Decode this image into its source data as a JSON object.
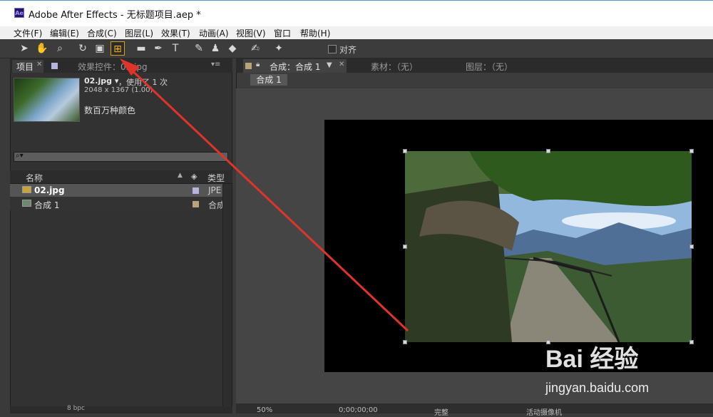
{
  "window": {
    "title": "Adobe After Effects - 无标题项目.aep *",
    "logo_text": "Ae"
  },
  "menu": [
    "文件(F)",
    "编辑(E)",
    "合成(C)",
    "图层(L)",
    "效果(T)",
    "动画(A)",
    "视图(V)",
    "窗口",
    "帮助(H)"
  ],
  "toolbar": {
    "tools": [
      "selection-tool",
      "hand-tool",
      "zoom-tool",
      "rotation-tool",
      "camera-tool",
      "pan-behind-tool",
      "rectangle-tool",
      "pen-tool",
      "text-tool",
      "brush-tool",
      "clone-stamp-tool",
      "eraser-tool",
      "roto-brush-tool",
      "puppet-pin-tool"
    ],
    "snap_label": "对齐"
  },
  "project_panel": {
    "tab_project": "项目",
    "tab_effects": "效果控件：02.jpg",
    "footage": {
      "name": "02.jpg ▾",
      "usage": "，使用了 1 次",
      "dims": "2048 x 1367 (1.00)",
      "color": "数百万种颜色"
    },
    "search_icon": "⌕▾",
    "columns": {
      "name": "名称",
      "type": "类型"
    },
    "items": [
      {
        "name": "02.jpg",
        "type": "JPE",
        "swatch": "#b4b4de"
      },
      {
        "name": "合成 1",
        "type": "合成",
        "swatch": "#b9a37a"
      }
    ],
    "footer_bpc": "8 bpc"
  },
  "comp_panel": {
    "tab_comp": "合成：合成 1",
    "tab_footage": "素材：（无）",
    "tab_layer": "图层：（无）",
    "subtab": "合成 1",
    "footer": {
      "zoom": "50%",
      "timecode": "0;00;00;00",
      "resolution": "完整",
      "camera": "活动摄像机"
    }
  },
  "watermark": {
    "logo": "Bai 经验",
    "url": "jingyan.baidu.com"
  },
  "colors": {
    "accent": "#d9a11a",
    "arrow": "#e0342a",
    "panel": "#323232"
  }
}
